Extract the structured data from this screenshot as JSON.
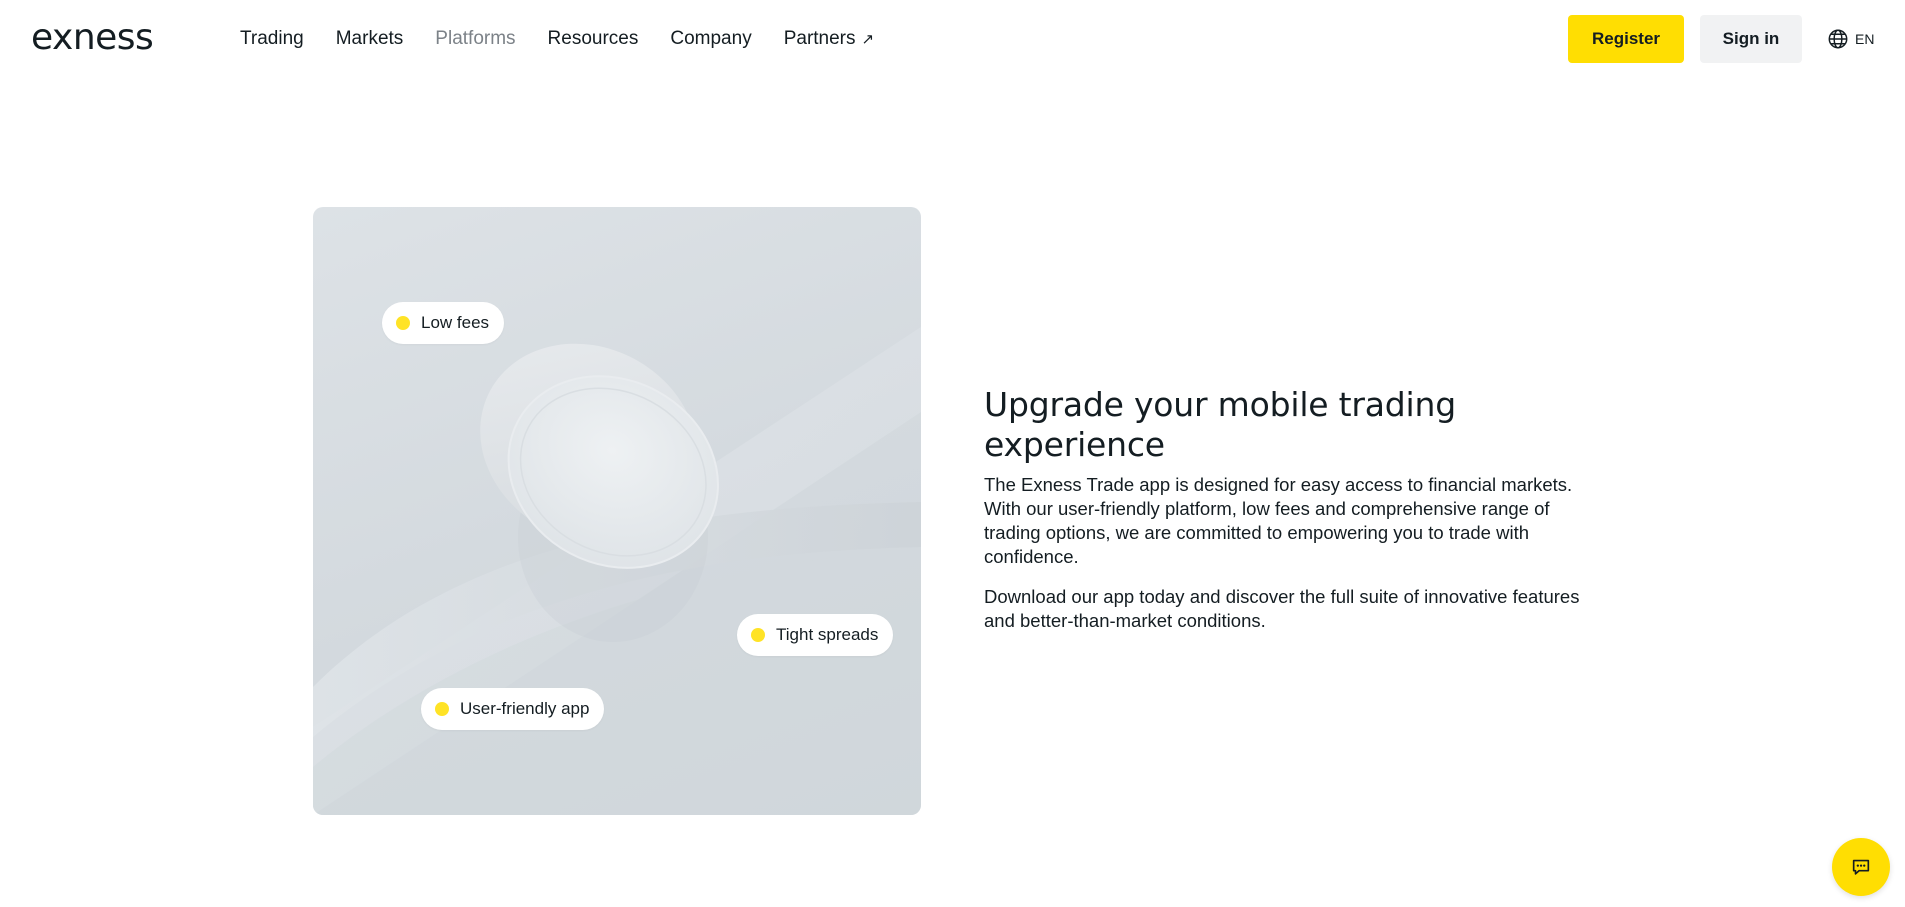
{
  "brand": {
    "logo_text": "exness",
    "accent_color": "#ffde02"
  },
  "nav": {
    "items": [
      {
        "label": "Trading"
      },
      {
        "label": "Markets"
      },
      {
        "label": "Platforms",
        "active": true
      },
      {
        "label": "Resources"
      },
      {
        "label": "Company"
      },
      {
        "label": "Partners",
        "icon": "external-arrow-icon"
      }
    ],
    "partners_arrow": "↗"
  },
  "header_actions": {
    "register_label": "Register",
    "signin_label": "Sign in",
    "language_icon": "globe-icon",
    "language_label": "EN"
  },
  "hero_card": {
    "badges": [
      {
        "label": "Low fees"
      },
      {
        "label": "Tight spreads"
      },
      {
        "label": "User-friendly app"
      }
    ],
    "badge_dot_color": "#ffe326"
  },
  "content": {
    "title": "Upgrade your mobile trading experience",
    "paragraph_1": "The Exness Trade app is designed for easy access to financial markets. With our user-friendly platform, low fees and comprehensive range of trading options, we are committed to empowering you to trade with confidence.",
    "paragraph_2": "Download our app today and discover the full suite of innovative features and better-than-market conditions."
  },
  "chat": {
    "icon": "chat-bubble-icon"
  }
}
